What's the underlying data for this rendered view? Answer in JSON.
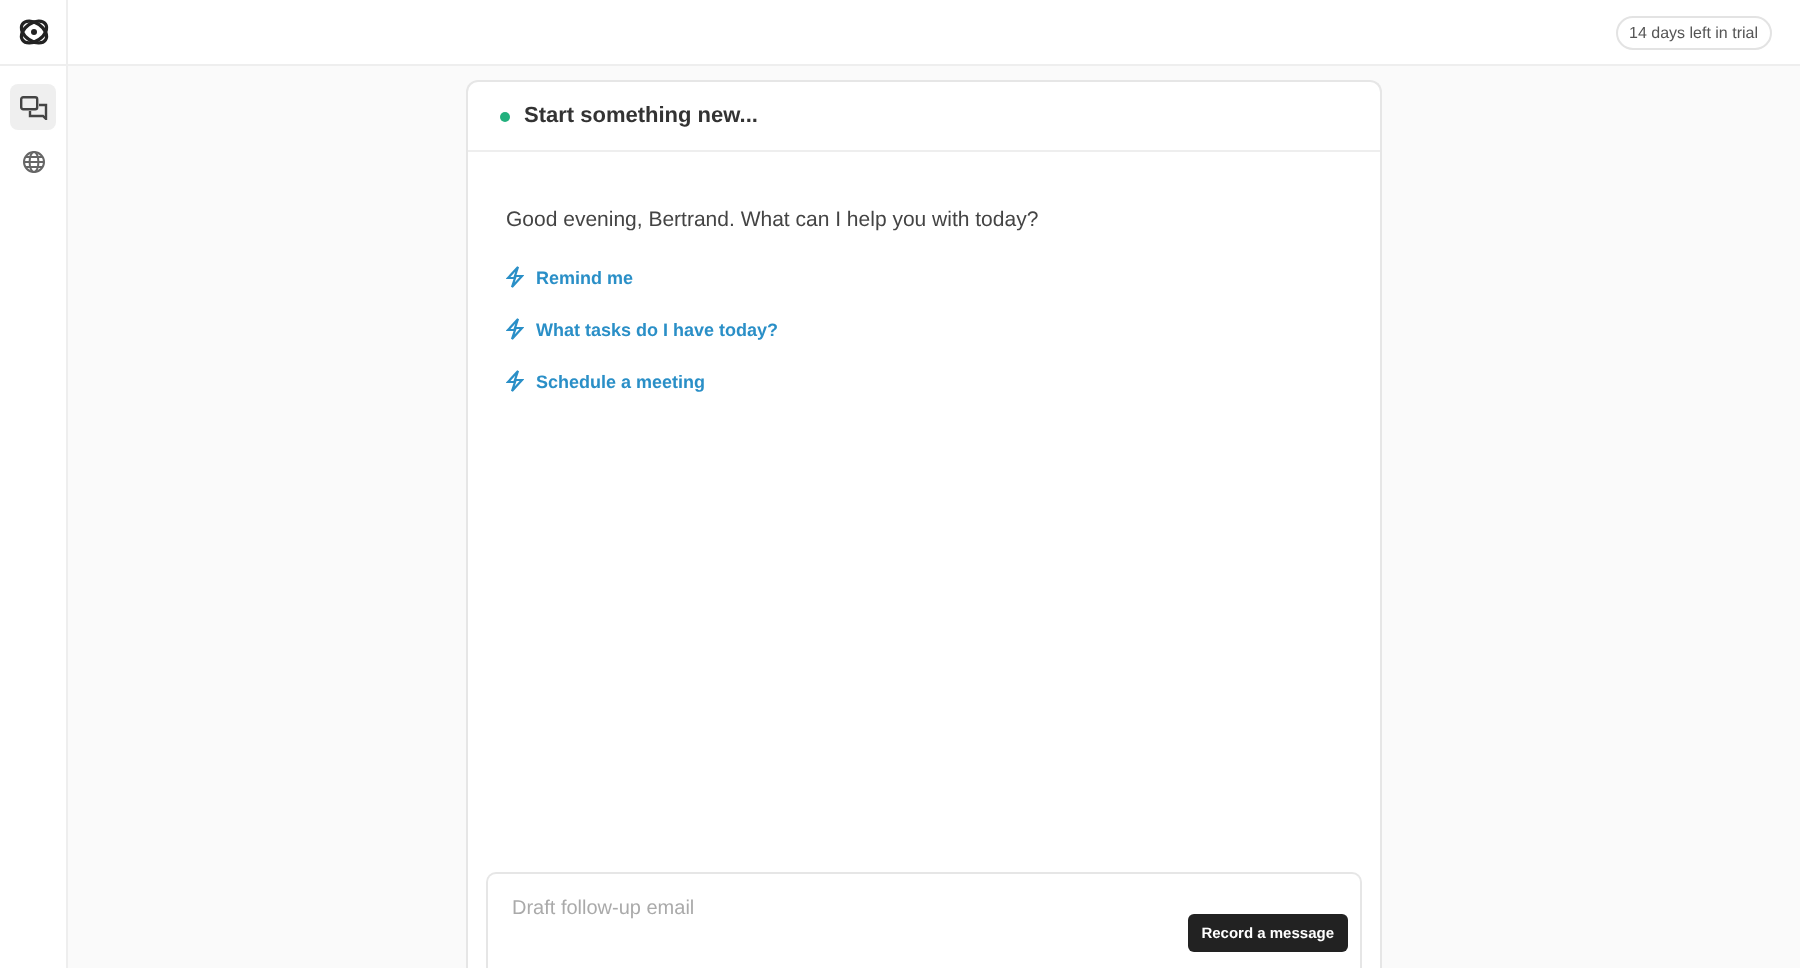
{
  "header": {
    "trial_badge": "14 days left in trial"
  },
  "sidebar": {
    "items": [
      {
        "kind": "chat",
        "selected": true
      },
      {
        "kind": "globe",
        "selected": false
      }
    ]
  },
  "chat": {
    "title": "Start something new...",
    "greeting": "Good evening, Bertrand. What can I help you with today?",
    "suggestions": [
      "Remind me",
      "What tasks do I have today?",
      "Schedule a meeting"
    ]
  },
  "composer": {
    "placeholder": "Draft follow-up email",
    "tooltip": "Record a message"
  }
}
